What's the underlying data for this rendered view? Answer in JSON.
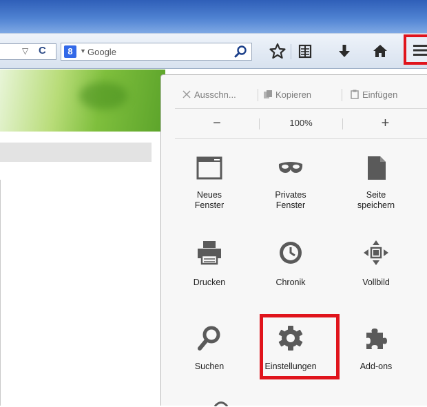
{
  "toolbar": {
    "search_placeholder": "Google",
    "search_engine_letter": "8",
    "icons": [
      "dropdown-arrow-icon",
      "reload-icon",
      "search-icon",
      "bookmark-star-icon",
      "reading-list-icon",
      "download-icon",
      "home-icon",
      "menu-icon"
    ]
  },
  "menu": {
    "edit": {
      "cut": "Ausschn...",
      "copy": "Kopieren",
      "paste": "Einfügen"
    },
    "zoom": {
      "minus": "−",
      "value": "100%",
      "plus": "+"
    },
    "items": [
      {
        "line1": "Neues",
        "line2": "Fenster",
        "icon": "new-window-icon"
      },
      {
        "line1": "Privates",
        "line2": "Fenster",
        "icon": "private-mask-icon"
      },
      {
        "line1": "Seite",
        "line2": "speichern",
        "icon": "save-page-icon"
      },
      {
        "line1": "Drucken",
        "icon": "print-icon"
      },
      {
        "line1": "Chronik",
        "icon": "history-clock-icon"
      },
      {
        "line1": "Vollbild",
        "icon": "fullscreen-icon"
      },
      {
        "line1": "Suchen",
        "icon": "find-icon"
      },
      {
        "line1": "Einstellungen",
        "icon": "settings-gear-icon"
      },
      {
        "line1": "Add-ons",
        "icon": "addons-puzzle-icon"
      }
    ]
  },
  "colors": {
    "highlight": "#e0141c",
    "icon_gray": "#5a5a5a",
    "titlebar": "#3a6cc2"
  }
}
